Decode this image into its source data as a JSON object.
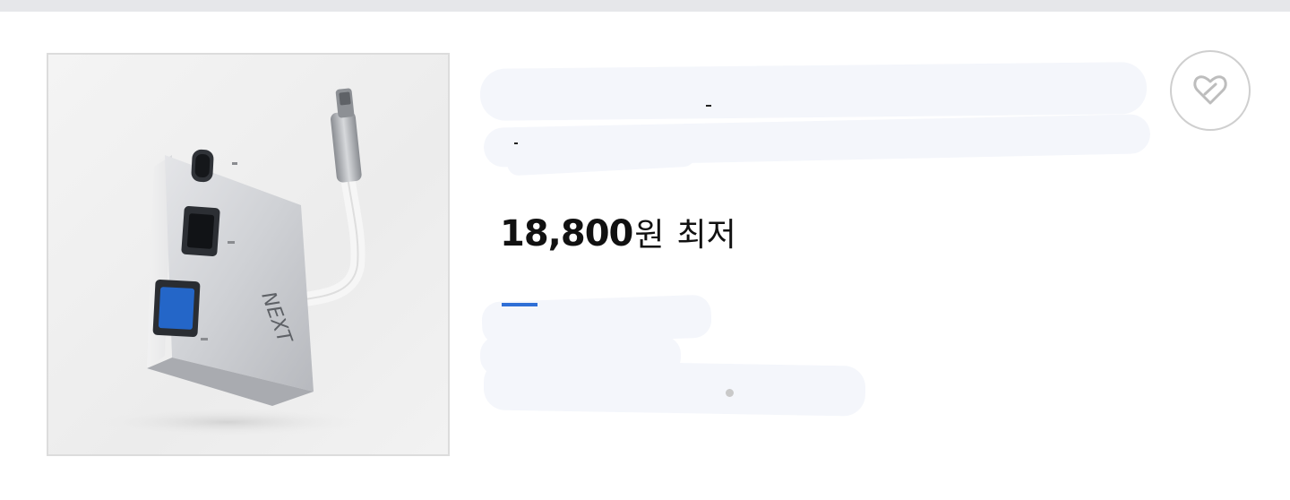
{
  "product": {
    "image_alt": "NEXT USB-C multiport adapter",
    "image_brand_text": "NEXT",
    "title_redacted": true,
    "price": {
      "amount": "18,800",
      "unit": "원",
      "label": "최저"
    },
    "details_redacted": true
  },
  "icons": {
    "wishlist": "heart-icon"
  },
  "colors": {
    "top_strip": "#e6e7ea",
    "price_text": "#111111",
    "redaction": "#f4f6fb",
    "accent_blue": "#2f6fd6",
    "wish_border": "#cfcfcf"
  }
}
